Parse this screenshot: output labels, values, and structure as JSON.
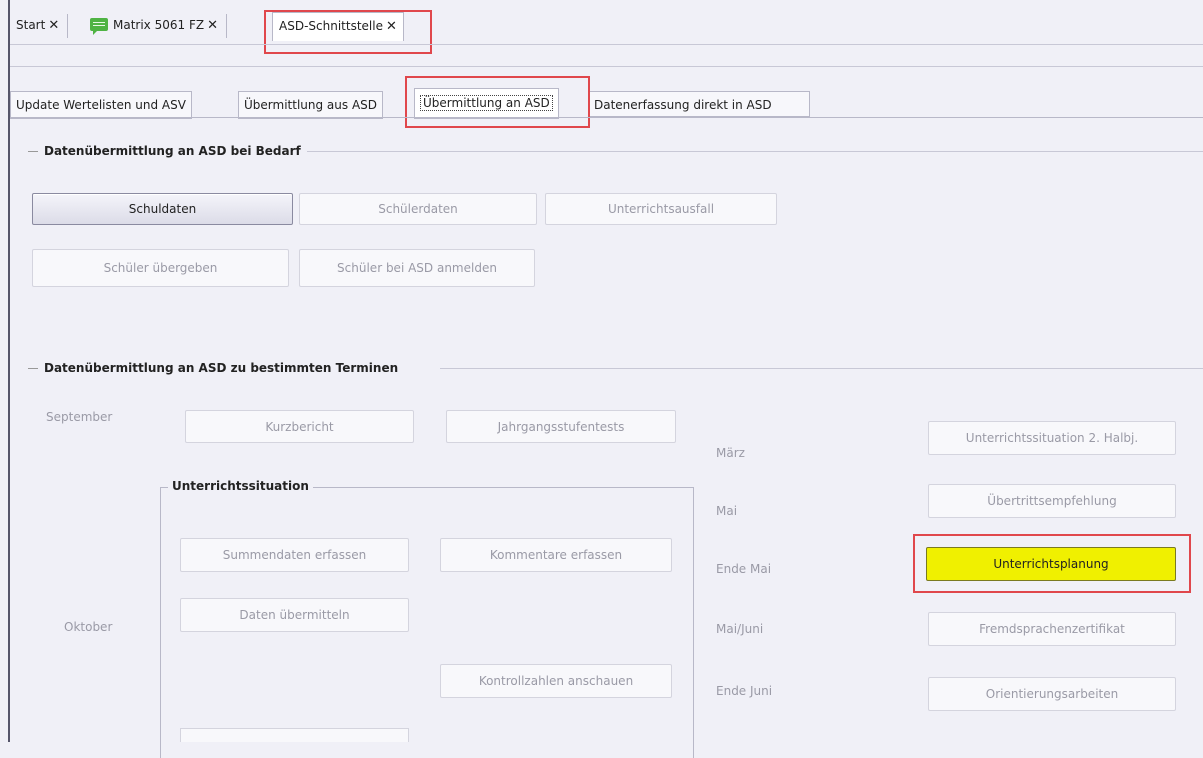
{
  "top_tabs": [
    {
      "label": "Start"
    },
    {
      "label": "Matrix 5061 FZ"
    },
    {
      "label": "ASD-Schnittstelle"
    }
  ],
  "close_glyph": "✕",
  "sub_tabs": [
    {
      "label": "Update Wertelisten und ASV"
    },
    {
      "label": "Übermittlung aus ASD"
    },
    {
      "label": "Übermittlung an ASD"
    },
    {
      "label": "Datenerfassung direkt in ASD"
    }
  ],
  "group_bedarf": {
    "title": "Datenübermittlung an ASD bei Bedarf",
    "buttons": [
      "Schuldaten",
      "Schülerdaten",
      "Unterrichtsausfall",
      "Schüler übergeben",
      "Schüler bei ASD anmelden"
    ]
  },
  "group_termine": {
    "title": "Datenübermittlung an ASD zu bestimmten Terminen",
    "months_left": {
      "september": "September",
      "oktober": "Oktober"
    },
    "september_buttons": [
      "Kurzbericht",
      "Jahrgangsstufentests"
    ],
    "unterricht": {
      "title": "Unterrichtssituation",
      "buttons": [
        "Summendaten erfassen",
        "Kommentare erfassen",
        "Daten übermitteln",
        "Kontrollzahlen anschauen"
      ]
    },
    "right": [
      {
        "month": "März",
        "button": "Unterrichtssituation 2. Halbj."
      },
      {
        "month": "Mai",
        "button": "Übertrittsempfehlung"
      },
      {
        "month": "Ende Mai",
        "button": "Unterrichtsplanung"
      },
      {
        "month": "Mai/Juni",
        "button": "Fremdsprachenzertifikat"
      },
      {
        "month": "Ende Juni",
        "button": "Orientierungsarbeiten"
      }
    ]
  },
  "colors": {
    "highlight": "#e0474c",
    "active_button": "#f0f000",
    "chat_icon": "#4fb344"
  }
}
